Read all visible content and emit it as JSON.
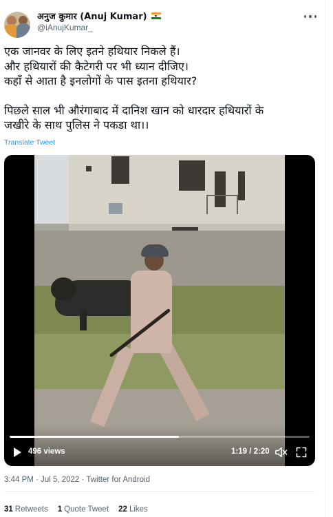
{
  "author": {
    "display_name": "अनुज कुमार (Anuj Kumar)",
    "handle": "@iAnujKumar_",
    "flag_icon": "india-flag-icon"
  },
  "tweet": {
    "lines": [
      "एक जानवर के लिए इतने हथियार निकले हैं।",
      "और हथियारों की कैटेगरी पर भी ध्यान दीजिए।",
      "कहाँ से आता है इनलोगों के पास इतना हथियार?",
      "पिछले साल भी औरंगाबाद में दानिश खान को धारदार हथियारों के",
      "जखीरे के साथ पुलिस ने पकडा था।।"
    ],
    "translate_label": "Translate Tweet"
  },
  "video": {
    "views": "496 views",
    "time": "1:19 / 2:20",
    "progress_fraction": 0.564
  },
  "meta": {
    "timestamp": "3:44 PM · Jul 5, 2022 · Twitter for Android"
  },
  "stats": {
    "retweets_count": "31",
    "retweets_label": "Retweets",
    "quotes_count": "1",
    "quotes_label": "Quote Tweet",
    "likes_count": "22",
    "likes_label": "Likes"
  },
  "colors": {
    "link": "#1d9bf0",
    "secondary_text": "#536471",
    "primary_text": "#0f1419"
  }
}
